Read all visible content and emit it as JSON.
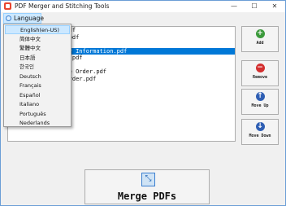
{
  "window": {
    "title": "PDF Merger and Stitching Tools"
  },
  "titlebar_buttons": {
    "minimize": "—",
    "maximize": "☐",
    "close": "✕"
  },
  "menu": {
    "language_label": "Language"
  },
  "language_menu": {
    "items": [
      "English(en-US)",
      "简体中文",
      "繁體中文",
      "日本語",
      "한국인",
      "Deutsch",
      "Français",
      "Español",
      "Italiano",
      "Português",
      "Nederlands"
    ],
    "highlighted": "English(en-US)"
  },
  "files": [
    "top\\Files\\33333.pdf",
    "top\\Files\\202222.pdf",
    "top\\Files\\ccc.pdf",
    "top\\Files\\Customer Information.pdf",
    "top\\Files\\MyExcel.pdf",
    "top\\Files\\new.pdf",
    "top\\Files\\Purchase Order.pdf",
    "top\\Files\\Sales Order.pdf"
  ],
  "selected_file": "top\\Files\\Customer Information.pdf",
  "buttons": {
    "add": "Add",
    "remove": "Remove",
    "move_up": "Move Up",
    "move_down": "Move Down",
    "merge": "Merge PDFs"
  },
  "colors": {
    "add": "#3c9a3c",
    "remove": "#d32f2f",
    "move_up": "#2f5fb4",
    "move_down": "#2f5fb4",
    "selection": "#0078d7"
  }
}
